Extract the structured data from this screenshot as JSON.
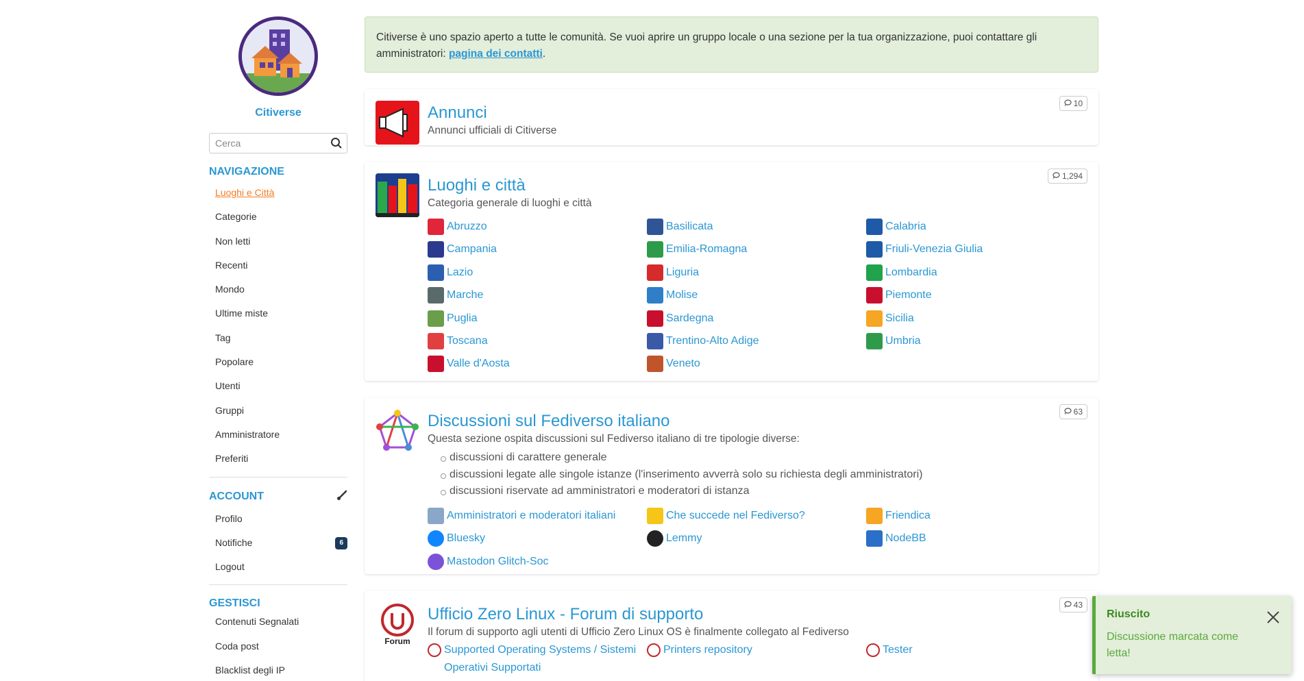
{
  "site": {
    "name": "Citiverse"
  },
  "search": {
    "placeholder": "Cerca"
  },
  "nav": {
    "title": "NAVIGAZIONE",
    "items": [
      "Luoghi e Città",
      "Categorie",
      "Non letti",
      "Recenti",
      "Mondo",
      "Ultime miste",
      "Tag",
      "Popolare",
      "Utenti",
      "Gruppi",
      "Amministratore",
      "Preferiti"
    ]
  },
  "account": {
    "title": "ACCOUNT",
    "items": [
      "Profilo",
      "Notifiche",
      "Logout"
    ],
    "notifications_count": "6"
  },
  "manage": {
    "title": "GESTISCI",
    "items": [
      "Contenuti Segnalati",
      "Coda post",
      "Blacklist degli IP"
    ]
  },
  "notice": {
    "text": "Citiverse è uno spazio aperto a tutte le comunità. Se vuoi aprire un gruppo locale o una sezione per la tua organizzazione, puoi contattare gli amministratori: ",
    "link": "pagina dei contatti",
    "end": "."
  },
  "categories": [
    {
      "title": "Annunci",
      "desc": "Annunci ufficiali di Citiverse",
      "count": "10"
    },
    {
      "title": "Luoghi e città",
      "desc": "Categoria generale di luoghi e città",
      "count": "1,294",
      "subs": [
        "Abruzzo",
        "Basilicata",
        "Calabria",
        "Campania",
        "Emilia-Romagna",
        "Friuli-Venezia Giulia",
        "Lazio",
        "Liguria",
        "Lombardia",
        "Marche",
        "Molise",
        "Piemonte",
        "Puglia",
        "Sardegna",
        "Sicilia",
        "Toscana",
        "Trentino-Alto Adige",
        "Umbria",
        "Valle d'Aosta",
        "Veneto"
      ]
    },
    {
      "title": "Discussioni sul Fediverso italiano",
      "desc": "Questa sezione ospita discussioni sul Fediverso italiano di tre tipologie diverse:",
      "count": "63",
      "bullets": [
        "discussioni di carattere generale",
        "discussioni legate alle singole istanze (l'inserimento avverrà solo su richiesta degli amministratori)",
        "discussioni riservate ad amministratori e moderatori di istanza"
      ],
      "subs": [
        "Amministratori e moderatori italiani",
        "Che succede nel Fediverso?",
        "Friendica",
        "Bluesky",
        "Lemmy",
        "NodeBB",
        "Mastodon Glitch-Soc"
      ]
    },
    {
      "title": "Ufficio Zero Linux - Forum di supporto",
      "desc": "Il forum di supporto agli utenti di Ufficio Zero Linux OS è finalmente collegato al Fediverso",
      "count": "43",
      "icon_label": "Forum",
      "subs": [
        "Supported Operating Systems / Sistemi Operativi Supportati",
        "Printers repository",
        "Tester"
      ]
    }
  ],
  "toast": {
    "title": "Riuscito",
    "message": "Discussione marcata come letta!"
  },
  "colors": {
    "accent": "#2a97d3",
    "active": "#f47c20",
    "success": "#5aaa3b"
  }
}
